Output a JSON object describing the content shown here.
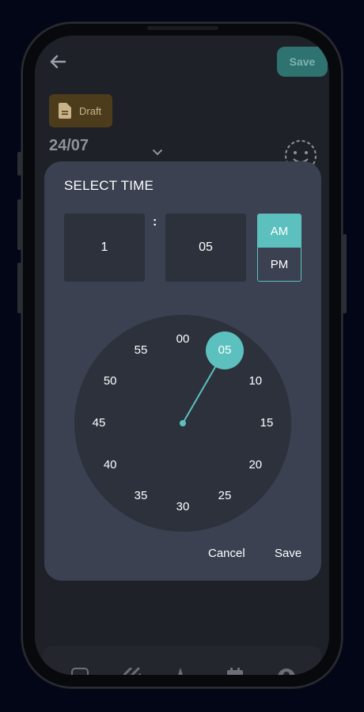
{
  "app": {
    "top_save_label": "Save",
    "draft_label": "Draft",
    "date_text": "24/07"
  },
  "dialog": {
    "title": "SELECT TIME",
    "hour": "1",
    "separator": ":",
    "minute": "05",
    "am_label": "AM",
    "pm_label": "PM",
    "selected_period": "AM",
    "cancel_label": "Cancel",
    "save_label": "Save"
  },
  "clock": {
    "selected_minute": 5,
    "numbers": [
      "00",
      "05",
      "10",
      "15",
      "20",
      "25",
      "30",
      "35",
      "40",
      "45",
      "50",
      "55"
    ]
  },
  "colors": {
    "accent": "#5cc1be",
    "dialog_bg": "#3b4151",
    "field_bg": "#2c313c",
    "screen_bg": "#1e2127"
  },
  "icons": {
    "back": "arrow-left-icon",
    "draft": "document-icon",
    "expand": "chevron-down-icon",
    "mood": "smiley-icon"
  }
}
